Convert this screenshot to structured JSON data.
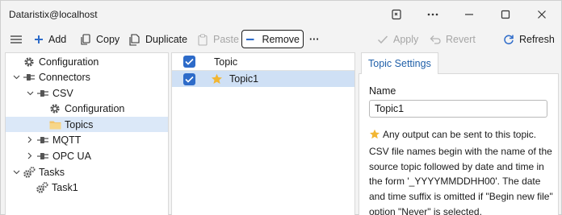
{
  "window": {
    "title": "Dataristix@localhost"
  },
  "titlebar_buttons": [
    {
      "name": "snap-layout-icon"
    },
    {
      "name": "more-options-icon"
    },
    {
      "name": "minimize-icon"
    },
    {
      "name": "maximize-icon"
    },
    {
      "name": "close-icon"
    }
  ],
  "toolbar": {
    "add": "Add",
    "copy": "Copy",
    "duplicate": "Duplicate",
    "paste": "Paste",
    "remove": "Remove",
    "more": "···",
    "apply": "Apply",
    "revert": "Revert",
    "refresh": "Refresh"
  },
  "tree": [
    {
      "label": "Configuration",
      "icon": "gear-icon",
      "level": 0,
      "chevron": ""
    },
    {
      "label": "Connectors",
      "icon": "connector-icon",
      "level": 0,
      "chevron": "down"
    },
    {
      "label": "CSV",
      "icon": "connector-icon",
      "level": 1,
      "chevron": "down"
    },
    {
      "label": "Configuration",
      "icon": "gear-icon",
      "level": 2,
      "chevron": ""
    },
    {
      "label": "Topics",
      "icon": "folder-icon",
      "level": 2,
      "chevron": "",
      "selected": true
    },
    {
      "label": "MQTT",
      "icon": "connector-icon",
      "level": 1,
      "chevron": "right"
    },
    {
      "label": "OPC UA",
      "icon": "connector-icon",
      "level": 1,
      "chevron": "right"
    },
    {
      "label": "Tasks",
      "icon": "gears-icon",
      "level": 0,
      "chevron": "down"
    },
    {
      "label": "Task1",
      "icon": "gears-icon",
      "level": 1,
      "chevron": ""
    }
  ],
  "topics": {
    "header": "Topic",
    "rows": [
      {
        "label": "Topic1",
        "checked": true
      }
    ]
  },
  "settings": {
    "tab": "Topic Settings",
    "name_label": "Name",
    "name_value": "Topic1",
    "description": "Any output can be sent to this topic. CSV file names begin with the name of the source topic followed by date and time in the form '_YYYYMMDDHH00'. The date and time suffix is omitted if \"Begin new file\" option \"Never\" is selected."
  },
  "colors": {
    "accent": "#2d6bc9",
    "selection": "#dbe8f8",
    "star": "#f2b632",
    "tab_text": "#1f5fa8"
  }
}
